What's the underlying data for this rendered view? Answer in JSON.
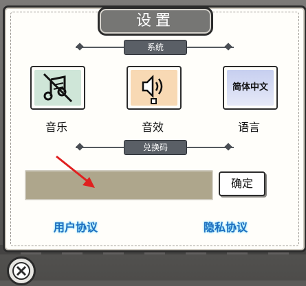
{
  "dialog": {
    "title": "设置"
  },
  "sections": {
    "system": "系统",
    "redeem": "兑换码"
  },
  "tiles": [
    {
      "label": "音乐",
      "icon": "music-off-icon"
    },
    {
      "label": "音效",
      "icon": "speaker-icon"
    },
    {
      "label": "语言",
      "icon": "language-icon",
      "icon_text": "简体中文"
    }
  ],
  "redeem": {
    "input_value": "",
    "confirm_label": "确定"
  },
  "links": {
    "user_agreement": "用户协议",
    "privacy_policy": "隐私协议"
  },
  "colors": {
    "music_tile": "#cfe6d8",
    "sound_tile": "#f8d9b4",
    "language_tile": "#c7cff0",
    "link": "#1f6fbf",
    "input_bg": "#aea68c",
    "arrow": "#e02020"
  }
}
